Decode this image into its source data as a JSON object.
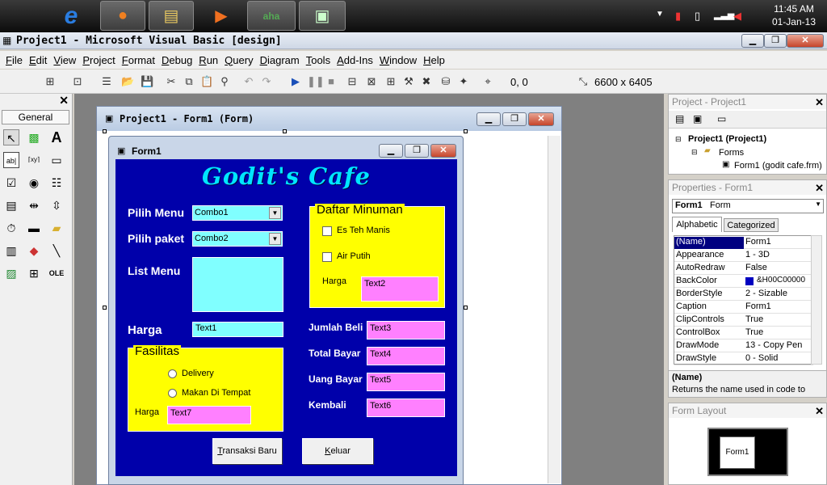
{
  "taskbar": {
    "clock_time": "11:45 AM",
    "clock_date": "01-Jan-13",
    "apps": [
      "apple-icon",
      "ie-icon",
      "firefox-icon",
      "explorer-icon",
      "media-player-icon",
      "aha-icon",
      "vb-icon"
    ]
  },
  "titlebar": {
    "title": "Project1 - Microsoft Visual Basic [design]"
  },
  "menu": [
    "File",
    "Edit",
    "View",
    "Project",
    "Format",
    "Debug",
    "Run",
    "Query",
    "Diagram",
    "Tools",
    "Add-Ins",
    "Window",
    "Help"
  ],
  "toolbar": {
    "position": "0, 0",
    "size": "6600 x 6405"
  },
  "toolbox": {
    "title": "General"
  },
  "designer": {
    "title": "Project1 - Form1 (Form)"
  },
  "form": {
    "title": "Form1",
    "heading": "Godit's Cafe",
    "labels": {
      "pilih_menu": "Pilih Menu",
      "pilih_paket": "Pilih paket",
      "list_menu": "List Menu",
      "harga": "Harga",
      "jumlah_beli": "Jumlah Beli",
      "total_bayar": "Total Bayar",
      "uang_bayar": "Uang Bayar",
      "kembali": "Kembali"
    },
    "combo1": "Combo1",
    "combo2": "Combo2",
    "text1": "Text1",
    "text2": "Text2",
    "text3": "Text3",
    "text4": "Text4",
    "text5": "Text5",
    "text6": "Text6",
    "text7": "Text7",
    "minuman": {
      "title": "Daftar Minuman",
      "item1": "Es Teh Manis",
      "item2": "Air Putih",
      "harga": "Harga"
    },
    "fasilitas": {
      "title": "Fasilitas",
      "opt1": "Delivery",
      "opt2": "Makan Di Tempat",
      "harga": "Harga"
    },
    "buttons": {
      "transaksi": "Transaksi Baru",
      "keluar": "Keluar"
    }
  },
  "project_panel": {
    "title": "Project - Project1",
    "root": "Project1 (Project1)",
    "folder": "Forms",
    "item": "Form1 (godit cafe.frm)"
  },
  "properties_panel": {
    "title": "Properties - Form1",
    "object": "Form1",
    "object_type": "Form",
    "tabs": [
      "Alphabetic",
      "Categorized"
    ],
    "rows": [
      [
        "(Name)",
        "Form1"
      ],
      [
        "Appearance",
        "1 - 3D"
      ],
      [
        "AutoRedraw",
        "False"
      ],
      [
        "BackColor",
        "&H00C00000"
      ],
      [
        "BorderStyle",
        "2 - Sizable"
      ],
      [
        "Caption",
        "Form1"
      ],
      [
        "ClipControls",
        "True"
      ],
      [
        "ControlBox",
        "True"
      ],
      [
        "DrawMode",
        "13 - Copy Pen"
      ],
      [
        "DrawStyle",
        "0 - Solid"
      ]
    ],
    "desc_title": "(Name)",
    "desc_text": "Returns the name used in code to"
  },
  "layout_panel": {
    "title": "Form Layout",
    "form_label": "Form1"
  },
  "colors": {
    "form_back": "#0000aa",
    "accent_cyan": "#80ffff",
    "accent_pink": "#ff80ff",
    "frame_yellow": "#ffff00"
  }
}
